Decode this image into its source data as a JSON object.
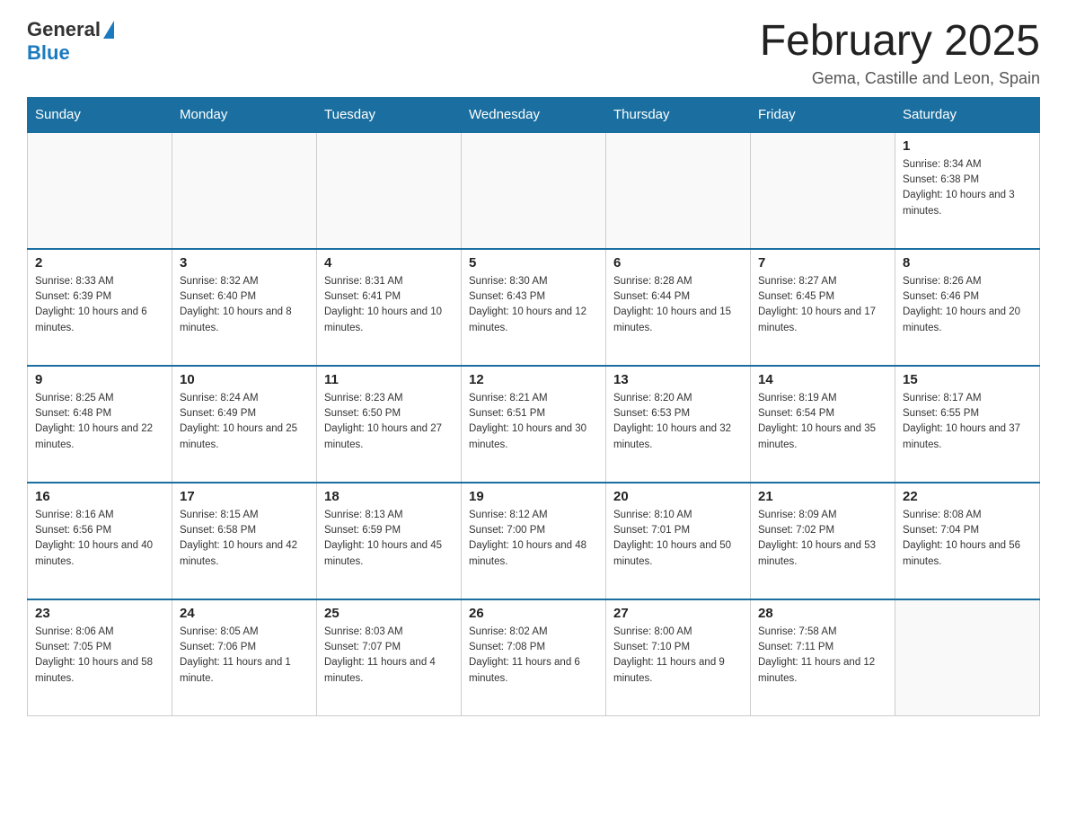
{
  "header": {
    "logo_general": "General",
    "logo_blue": "Blue",
    "title": "February 2025",
    "subtitle": "Gema, Castille and Leon, Spain"
  },
  "days_of_week": [
    "Sunday",
    "Monday",
    "Tuesday",
    "Wednesday",
    "Thursday",
    "Friday",
    "Saturday"
  ],
  "weeks": [
    [
      {
        "day": "",
        "info": ""
      },
      {
        "day": "",
        "info": ""
      },
      {
        "day": "",
        "info": ""
      },
      {
        "day": "",
        "info": ""
      },
      {
        "day": "",
        "info": ""
      },
      {
        "day": "",
        "info": ""
      },
      {
        "day": "1",
        "info": "Sunrise: 8:34 AM\nSunset: 6:38 PM\nDaylight: 10 hours and 3 minutes."
      }
    ],
    [
      {
        "day": "2",
        "info": "Sunrise: 8:33 AM\nSunset: 6:39 PM\nDaylight: 10 hours and 6 minutes."
      },
      {
        "day": "3",
        "info": "Sunrise: 8:32 AM\nSunset: 6:40 PM\nDaylight: 10 hours and 8 minutes."
      },
      {
        "day": "4",
        "info": "Sunrise: 8:31 AM\nSunset: 6:41 PM\nDaylight: 10 hours and 10 minutes."
      },
      {
        "day": "5",
        "info": "Sunrise: 8:30 AM\nSunset: 6:43 PM\nDaylight: 10 hours and 12 minutes."
      },
      {
        "day": "6",
        "info": "Sunrise: 8:28 AM\nSunset: 6:44 PM\nDaylight: 10 hours and 15 minutes."
      },
      {
        "day": "7",
        "info": "Sunrise: 8:27 AM\nSunset: 6:45 PM\nDaylight: 10 hours and 17 minutes."
      },
      {
        "day": "8",
        "info": "Sunrise: 8:26 AM\nSunset: 6:46 PM\nDaylight: 10 hours and 20 minutes."
      }
    ],
    [
      {
        "day": "9",
        "info": "Sunrise: 8:25 AM\nSunset: 6:48 PM\nDaylight: 10 hours and 22 minutes."
      },
      {
        "day": "10",
        "info": "Sunrise: 8:24 AM\nSunset: 6:49 PM\nDaylight: 10 hours and 25 minutes."
      },
      {
        "day": "11",
        "info": "Sunrise: 8:23 AM\nSunset: 6:50 PM\nDaylight: 10 hours and 27 minutes."
      },
      {
        "day": "12",
        "info": "Sunrise: 8:21 AM\nSunset: 6:51 PM\nDaylight: 10 hours and 30 minutes."
      },
      {
        "day": "13",
        "info": "Sunrise: 8:20 AM\nSunset: 6:53 PM\nDaylight: 10 hours and 32 minutes."
      },
      {
        "day": "14",
        "info": "Sunrise: 8:19 AM\nSunset: 6:54 PM\nDaylight: 10 hours and 35 minutes."
      },
      {
        "day": "15",
        "info": "Sunrise: 8:17 AM\nSunset: 6:55 PM\nDaylight: 10 hours and 37 minutes."
      }
    ],
    [
      {
        "day": "16",
        "info": "Sunrise: 8:16 AM\nSunset: 6:56 PM\nDaylight: 10 hours and 40 minutes."
      },
      {
        "day": "17",
        "info": "Sunrise: 8:15 AM\nSunset: 6:58 PM\nDaylight: 10 hours and 42 minutes."
      },
      {
        "day": "18",
        "info": "Sunrise: 8:13 AM\nSunset: 6:59 PM\nDaylight: 10 hours and 45 minutes."
      },
      {
        "day": "19",
        "info": "Sunrise: 8:12 AM\nSunset: 7:00 PM\nDaylight: 10 hours and 48 minutes."
      },
      {
        "day": "20",
        "info": "Sunrise: 8:10 AM\nSunset: 7:01 PM\nDaylight: 10 hours and 50 minutes."
      },
      {
        "day": "21",
        "info": "Sunrise: 8:09 AM\nSunset: 7:02 PM\nDaylight: 10 hours and 53 minutes."
      },
      {
        "day": "22",
        "info": "Sunrise: 8:08 AM\nSunset: 7:04 PM\nDaylight: 10 hours and 56 minutes."
      }
    ],
    [
      {
        "day": "23",
        "info": "Sunrise: 8:06 AM\nSunset: 7:05 PM\nDaylight: 10 hours and 58 minutes."
      },
      {
        "day": "24",
        "info": "Sunrise: 8:05 AM\nSunset: 7:06 PM\nDaylight: 11 hours and 1 minute."
      },
      {
        "day": "25",
        "info": "Sunrise: 8:03 AM\nSunset: 7:07 PM\nDaylight: 11 hours and 4 minutes."
      },
      {
        "day": "26",
        "info": "Sunrise: 8:02 AM\nSunset: 7:08 PM\nDaylight: 11 hours and 6 minutes."
      },
      {
        "day": "27",
        "info": "Sunrise: 8:00 AM\nSunset: 7:10 PM\nDaylight: 11 hours and 9 minutes."
      },
      {
        "day": "28",
        "info": "Sunrise: 7:58 AM\nSunset: 7:11 PM\nDaylight: 11 hours and 12 minutes."
      },
      {
        "day": "",
        "info": ""
      }
    ]
  ]
}
